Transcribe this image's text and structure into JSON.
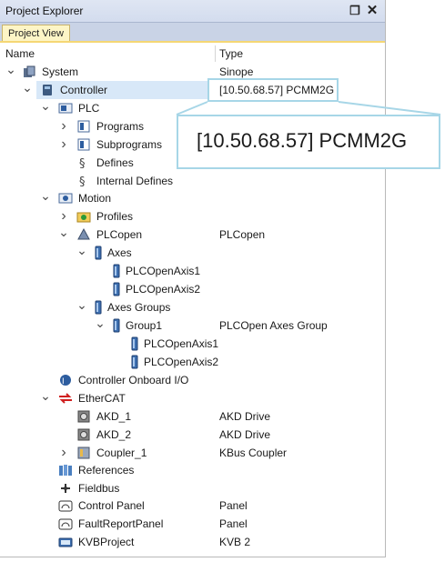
{
  "window": {
    "title": "Project Explorer",
    "tab": "Project View"
  },
  "columns": {
    "name": "Name",
    "type": "Type"
  },
  "tree": [
    {
      "label": "System",
      "type": "Sinope",
      "icon": "system-icon"
    },
    {
      "label": "Controller",
      "type": "[10.50.68.57] PCMM2G",
      "icon": "controller-icon",
      "selected": true
    },
    {
      "label": "PLC",
      "type": "",
      "icon": "plc-icon"
    },
    {
      "label": "Programs",
      "type": "",
      "icon": "programs-icon"
    },
    {
      "label": "Subprograms",
      "type": "",
      "icon": "subprograms-icon"
    },
    {
      "label": "Defines",
      "type": "",
      "icon": "defines-icon"
    },
    {
      "label": "Internal Defines",
      "type": "",
      "icon": "internal-defines-icon"
    },
    {
      "label": "Motion",
      "type": "",
      "icon": "motion-icon"
    },
    {
      "label": "Profiles",
      "type": "",
      "icon": "profiles-icon"
    },
    {
      "label": "PLCopen",
      "type": "PLCopen",
      "icon": "plcopen-icon"
    },
    {
      "label": "Axes",
      "type": "",
      "icon": "axes-icon"
    },
    {
      "label": "PLCOpenAxis1",
      "type": "",
      "icon": "axis-icon"
    },
    {
      "label": "PLCOpenAxis2",
      "type": "",
      "icon": "axis-icon"
    },
    {
      "label": "Axes Groups",
      "type": "",
      "icon": "axes-groups-icon"
    },
    {
      "label": "Group1",
      "type": "PLCOpen Axes Group",
      "icon": "group-icon"
    },
    {
      "label": "PLCOpenAxis1",
      "type": "",
      "icon": "axis-icon"
    },
    {
      "label": "PLCOpenAxis2",
      "type": "",
      "icon": "axis-icon"
    },
    {
      "label": "Controller Onboard I/O",
      "type": "",
      "icon": "onboard-io-icon"
    },
    {
      "label": "EtherCAT",
      "type": "",
      "icon": "ethercat-icon"
    },
    {
      "label": "AKD_1",
      "type": "AKD Drive",
      "icon": "drive-icon"
    },
    {
      "label": "AKD_2",
      "type": "AKD Drive",
      "icon": "drive-icon"
    },
    {
      "label": "Coupler_1",
      "type": "KBus Coupler",
      "icon": "coupler-icon"
    },
    {
      "label": "References",
      "type": "",
      "icon": "references-icon"
    },
    {
      "label": "Fieldbus",
      "type": "",
      "icon": "fieldbus-icon"
    },
    {
      "label": "Control Panel",
      "type": "Panel",
      "icon": "panel-icon"
    },
    {
      "label": "FaultReportPanel",
      "type": "Panel",
      "icon": "panel-icon"
    },
    {
      "label": "KVBProject",
      "type": "KVB 2",
      "icon": "kvb-icon"
    }
  ],
  "callout": {
    "text": "[10.50.68.57] PCMM2G"
  },
  "colors": {
    "accent": "#f5d774",
    "selection": "#d8e8f8",
    "callout_border": "#a7d6e7"
  }
}
